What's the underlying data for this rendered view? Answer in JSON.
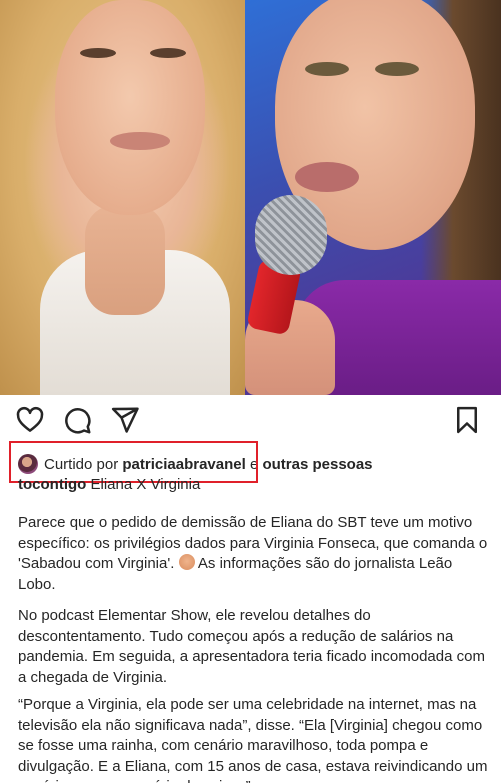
{
  "post": {
    "image_left_alt": "woman-blonde-hair",
    "image_right_alt": "woman-with-microphone",
    "actions": {
      "like_icon": "heart-icon",
      "comment_icon": "comment-icon",
      "share_icon": "send-icon",
      "save_icon": "bookmark-icon"
    },
    "likes": {
      "prefix": "Curtido por",
      "user": "patriciaabravanel",
      "suffix": "e",
      "others": "outras pessoas"
    },
    "caption_header": {
      "username": "tocontigo",
      "title": "Eliana X Virginia"
    },
    "paragraphs": {
      "p1a": "Parece que o pedido de demissão de Eliana do SBT teve um motivo específico: os privilégios dados para Virginia Fonseca, que comanda o 'Sabadou com Virginia'.",
      "p1b": "As informações são do jornalista Leão Lobo.",
      "p2": "No podcast Elementar Show, ele revelou detalhes do descontentamento. Tudo começou após a redução de salários na pandemia. Em seguida, a apresentadora teria ficado incomodada com a chegada de Virginia.",
      "p3": "“Porque a Virginia, ela pode ser uma celebridade na internet, mas na televisão ela não significava nada”, disse. “Ela [Virginia] chegou como se fosse uma rainha, com cenário maravilhoso, toda pompa e divulgação. E a Eliana, com 15 anos de casa, estava reivindicando um cenário novo, uma série de coisas”."
    },
    "highlight_color": "#e0202a"
  }
}
